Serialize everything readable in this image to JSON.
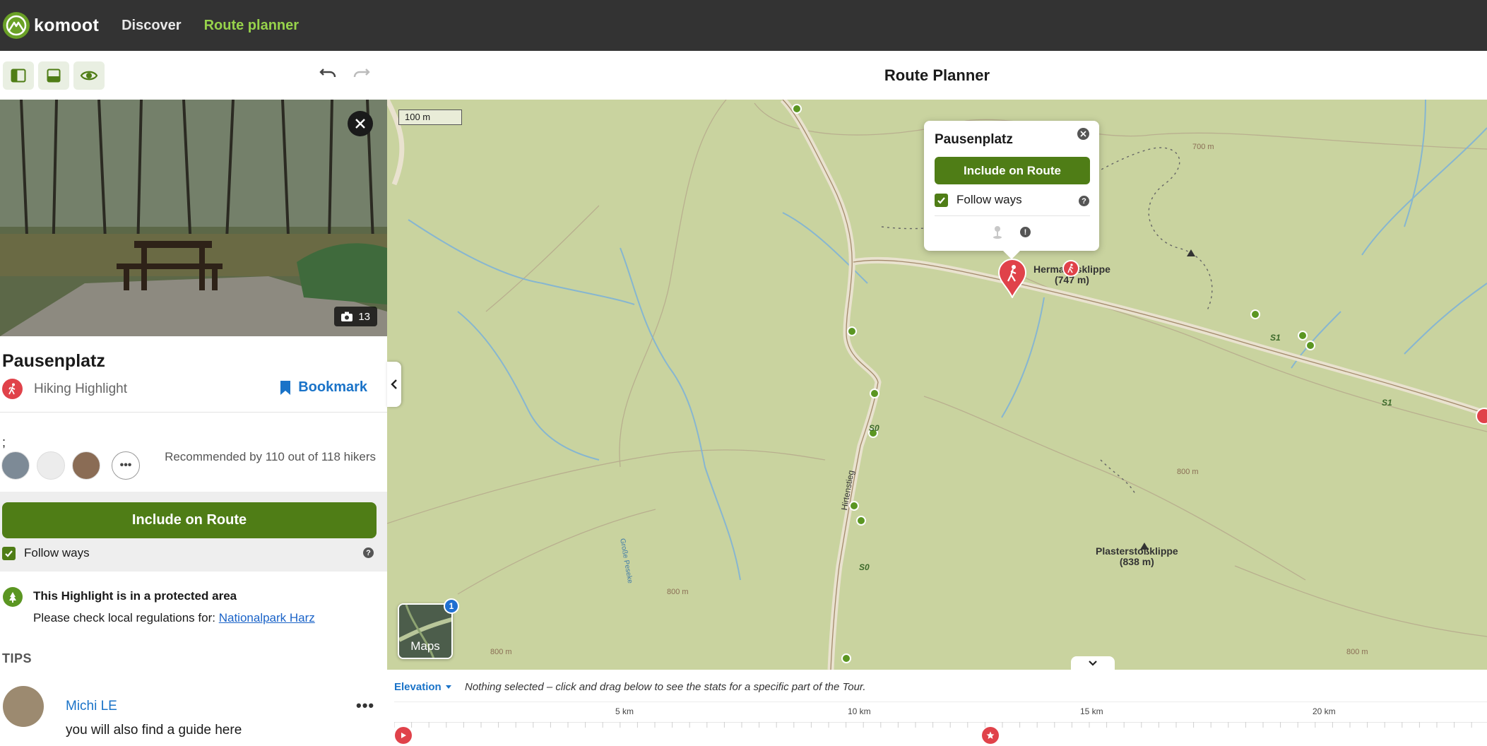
{
  "nav": {
    "brand": "komoot",
    "links": [
      {
        "label": "Discover",
        "active": false
      },
      {
        "label": "Route planner",
        "active": true
      }
    ]
  },
  "toolbar": {
    "title": "Route Planner"
  },
  "highlight": {
    "photo_count": "13",
    "title": "Pausenplatz",
    "type": "Hiking Highlight",
    "bookmark_label": "Bookmark",
    "separator_char": ";",
    "recommendation": "Recommended by 110 out of 118 hikers",
    "include_label": "Include on Route",
    "follow_ways_label": "Follow ways",
    "follow_ways_checked": true,
    "protected_title": "This Highlight is in a protected area",
    "protected_note": "Please check local regulations for:",
    "protected_link": "Nationalpark Harz"
  },
  "tips": {
    "heading": "TIPS",
    "items": [
      {
        "author": "Michi LE",
        "text": "you will also find a guide here"
      }
    ]
  },
  "map": {
    "scale_label": "100 m",
    "popup": {
      "title": "Pausenplatz",
      "include_label": "Include on Route",
      "follow_ways_label": "Follow ways"
    },
    "labels": {
      "hermann": "Hermannsklippe\n(747 m)",
      "hermann_line1": "Hermannsklippe",
      "hermann_line2": "(747 m)",
      "plaster_line1": "Plasterstoßklippe",
      "plaster_line2": "(838 m)",
      "contour_700": "700 m",
      "contour_800a": "800 m",
      "contour_800b": "800 m",
      "contour_800c": "800 m",
      "contour_800d": "800 m",
      "trail_s1a": "S1",
      "trail_s1b": "S1",
      "trail_s0a": "S0",
      "trail_s0b": "S0",
      "path_hirtenstieg": "Hirtenstieg",
      "stream": "Große Peseke"
    },
    "maps_button_label": "Maps",
    "maps_badge": "1"
  },
  "elevation": {
    "tab_label": "Elevation",
    "note": "Nothing selected – click and drag below to see the stats for a specific part of the Tour.",
    "ticks": [
      "5 km",
      "10 km",
      "15 km",
      "20 km"
    ]
  },
  "colors": {
    "brand_green": "#4f7d16",
    "nav_active": "#97d34b",
    "link_blue": "#1a73c8",
    "highlight_red": "#e0424a",
    "map_bg": "#c9d39f"
  }
}
